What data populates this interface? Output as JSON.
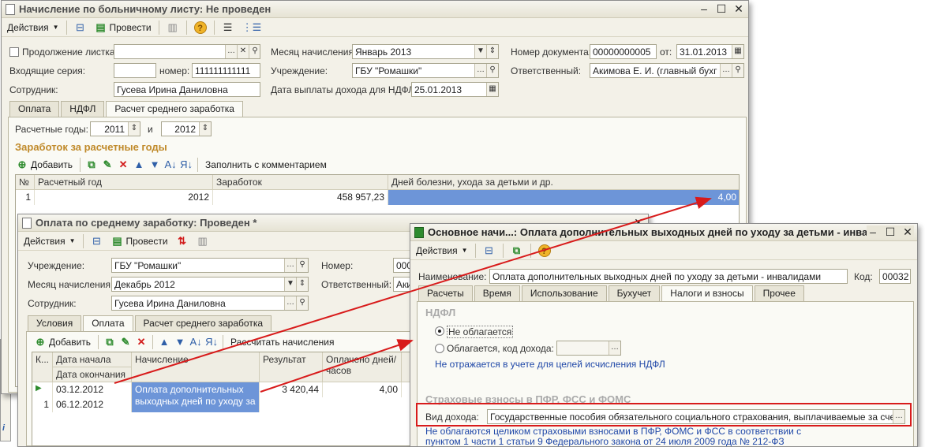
{
  "win1": {
    "title": "Начисление по больничному листу: Не проведен",
    "toolbar": {
      "actions": "Действия",
      "post": "Провести"
    },
    "continue_label": "Продолжение листка",
    "series_label": "Входящие серия:",
    "number_label": "номер:",
    "number_value": "111111111111",
    "employee_label": "Сотрудник:",
    "employee_value": "Гусева Ирина Даниловна",
    "month_label": "Месяц начисления:",
    "month_value": "Январь 2013",
    "org_label": "Учреждение:",
    "org_value": "ГБУ \"Ромашки\"",
    "pay_date_label": "Дата выплаты дохода для НДФЛ:",
    "pay_date_value": "25.01.2013",
    "doc_no_label": "Номер документа:",
    "doc_no_value": "00000000005",
    "from_label": "от:",
    "doc_date_value": "31.01.2013",
    "resp_label": "Ответственный:",
    "resp_value": "Акимова Е. И. (главный бухг",
    "tabs": [
      "Оплата",
      "НДФЛ",
      "Расчет среднего заработка"
    ],
    "years_label": "Расчетные годы:",
    "year_from": "2011",
    "and_label": "и",
    "year_to": "2012",
    "section_title": "Заработок за расчетные годы",
    "grid_toolbar": {
      "add": "Добавить",
      "fill": "Заполнить с комментарием"
    },
    "grid": {
      "headers": [
        "№",
        "Расчетный год",
        "Заработок",
        "Дней болезни, ухода за детьми и др."
      ],
      "row": {
        "n": "1",
        "year": "2012",
        "earnings": "458 957,23",
        "days": "4,00"
      }
    }
  },
  "win2": {
    "title": "Оплата по среднему заработку: Проведен *",
    "toolbar": {
      "actions": "Действия",
      "post": "Провести"
    },
    "org_label": "Учреждение:",
    "org_value": "ГБУ \"Ромашки\"",
    "month_label": "Месяц начисления:",
    "month_value": "Декабрь 2012",
    "employee_label": "Сотрудник:",
    "employee_value": "Гусева Ирина Даниловна",
    "number_label": "Номер:",
    "number_value": "000",
    "resp_label": "Ответственный:",
    "resp_value": "Аки",
    "tabs": [
      "Условия",
      "Оплата",
      "Расчет среднего заработка"
    ],
    "grid_toolbar": {
      "add": "Добавить",
      "calc": "Рассчитать начисления"
    },
    "grid": {
      "h_k": "К...",
      "h_date_start": "Дата начала",
      "h_date_end": "Дата окончания",
      "h_accrual": "Начисление",
      "h_result": "Результат",
      "h_paid": "Оплачено дней/часов",
      "row": {
        "n": "1",
        "date_start": "03.12.2012",
        "date_end": "06.12.2012",
        "accrual": "Оплата дополнительных выходных дней по уходу за ...",
        "result": "3 420,44",
        "paid": "4,00"
      }
    }
  },
  "win3": {
    "title": "Основное начи...: Оплата дополнительных выходных дней по уходу за детьми - инвалидами",
    "toolbar": {
      "actions": "Действия"
    },
    "name_label": "Наименование:",
    "name_value": "Оплата дополнительных выходных дней по уходу за детьми - инвалидами",
    "code_label": "Код:",
    "code_value": "00032",
    "tabs": [
      "Расчеты",
      "Время",
      "Использование",
      "Бухучет",
      "Налоги и взносы",
      "Прочее"
    ],
    "ndfl_title": "НДФЛ",
    "not_taxed": "Не облагается",
    "taxed_code": "Облагается, код дохода:",
    "ndfl_note": "Не отражается в учете для целей исчисления НДФЛ",
    "ins_title": "Страховые взносы в ПФР, ФСС и ФОМС",
    "income_type_label": "Вид дохода:",
    "income_type_value": "Государственные пособия обязательного социального страхования, выплачиваемые за счет ФСС",
    "ins_note_1": "Не облагаются целиком страховыми взносами в ПФР, ФОМС и ФСС в соответствии с",
    "ins_note_2": "пунктом 1 части 1 статьи 9 Федерального закона от 24 июля 2009 года № 212-ФЗ"
  },
  "colors": {
    "accent_red": "#d81b1b",
    "selection_blue": "#6d95d8",
    "section_orange": "#c08a2a",
    "link_blue": "#2048a8"
  }
}
